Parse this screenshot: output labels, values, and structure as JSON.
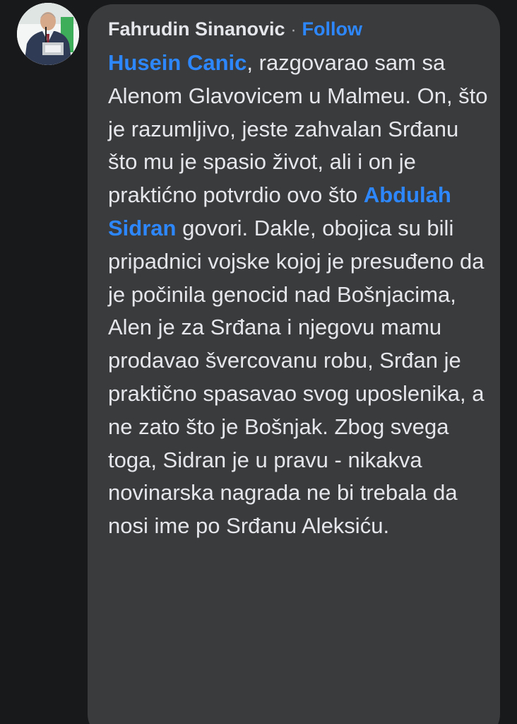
{
  "comment": {
    "author": "Fahrudin Sinanovic",
    "separator": "·",
    "follow_label": "Follow",
    "mention_1": "Husein Canic",
    "text_1": ", razgovarao sam sa Alenom Glavovicem u Malmeu. On, što je razumljivo, jeste zahvalan Srđanu što mu je spasio život, ali i on je praktićno potvrdio ovo što ",
    "mention_2": "Abdulah Sidran",
    "text_2": " govori. Dakle, obojica su bili pripadnici vojske kojoj je presuđeno da je počinila genocid nad Bošnjacima, Alen je za Srđana i njegovu mamu prodavao švercovanu robu, Srđan je praktično spasavao svog uposlenika, a ne zato što je Bošnjak. Zbog svega toga, Sidran je u pravu - nikakva novinarska nagrada ne bi trebala da nosi ime po Srđanu Aleksiću."
  },
  "colors": {
    "background": "#18191a",
    "bubble": "#3a3b3c",
    "text": "#e4e6eb",
    "link": "#2d88ff",
    "muted": "#b0b3b8"
  }
}
